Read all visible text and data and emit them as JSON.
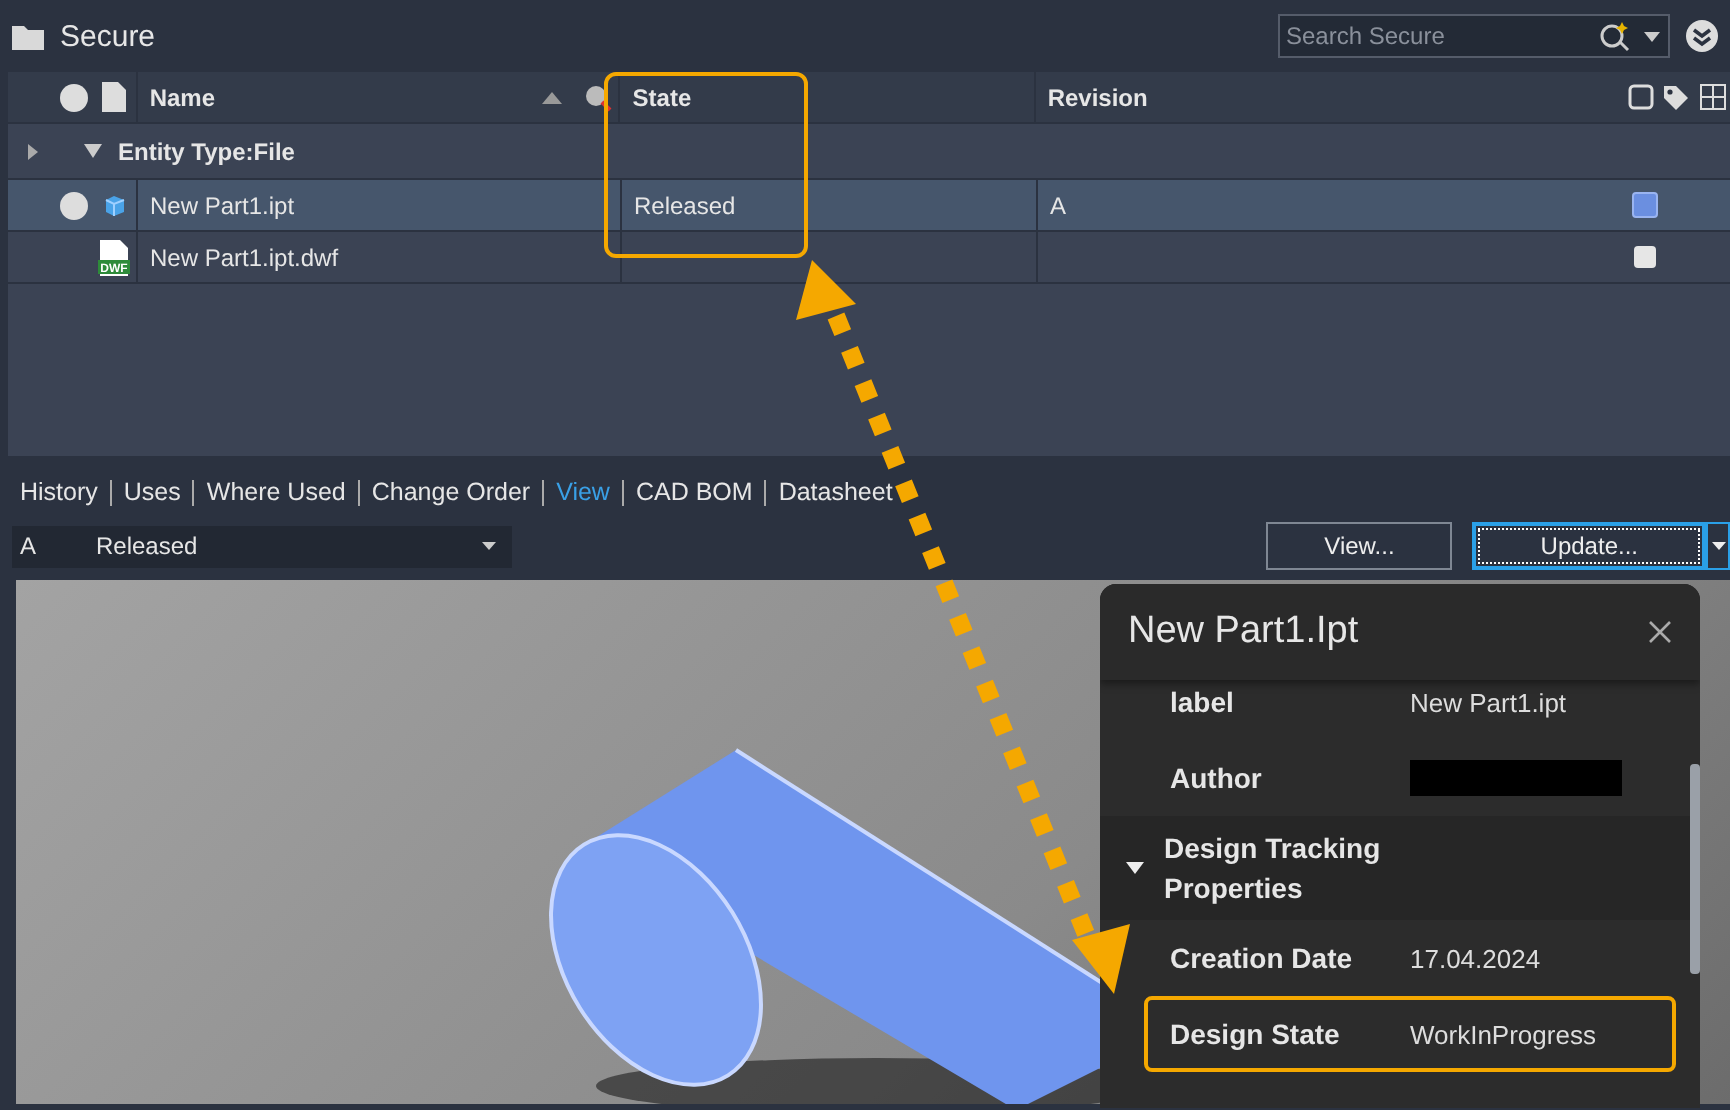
{
  "header": {
    "title": "Secure",
    "search": {
      "placeholder": "Search Secure"
    }
  },
  "table": {
    "columns": [
      {
        "label": "Name",
        "sorted": true
      },
      {
        "label": "State",
        "highlighted": true
      },
      {
        "label": "Revision"
      }
    ],
    "group": {
      "label": "Entity Type:File",
      "expanded": true
    },
    "rows": [
      {
        "kind": "part",
        "name": "New Part1.ipt",
        "state": "Released",
        "revision": "A",
        "selected": true,
        "checked": true
      },
      {
        "kind": "dwf",
        "icon_label": "DWF",
        "name": "New Part1.ipt.dwf",
        "state": "",
        "revision": "",
        "selected": false,
        "checked": false
      }
    ]
  },
  "tabs": [
    {
      "label": "History",
      "selected": false
    },
    {
      "label": "Uses",
      "selected": false
    },
    {
      "label": "Where Used",
      "selected": false
    },
    {
      "label": "Change Order",
      "selected": false
    },
    {
      "label": "View",
      "selected": true
    },
    {
      "label": "CAD BOM",
      "selected": false
    },
    {
      "label": "Datasheet",
      "selected": false
    }
  ],
  "revision_select": {
    "revision": "A",
    "state": "Released"
  },
  "buttons": [
    {
      "label": "View...",
      "focused": false
    },
    {
      "label": "Update...",
      "focused": true
    }
  ],
  "properties_panel": {
    "title": "New Part1.Ipt",
    "items": [
      {
        "kind": "property",
        "label": "label",
        "value": "New Part1.ipt"
      },
      {
        "kind": "redacted",
        "label": "Author"
      },
      {
        "kind": "section",
        "label": "Design Tracking Properties",
        "expanded": true
      },
      {
        "kind": "property",
        "label": "Creation Date",
        "value": "17.04.2024"
      },
      {
        "kind": "property",
        "label": "Design State",
        "value": "WorkInProgress",
        "highlighted": true
      }
    ]
  }
}
